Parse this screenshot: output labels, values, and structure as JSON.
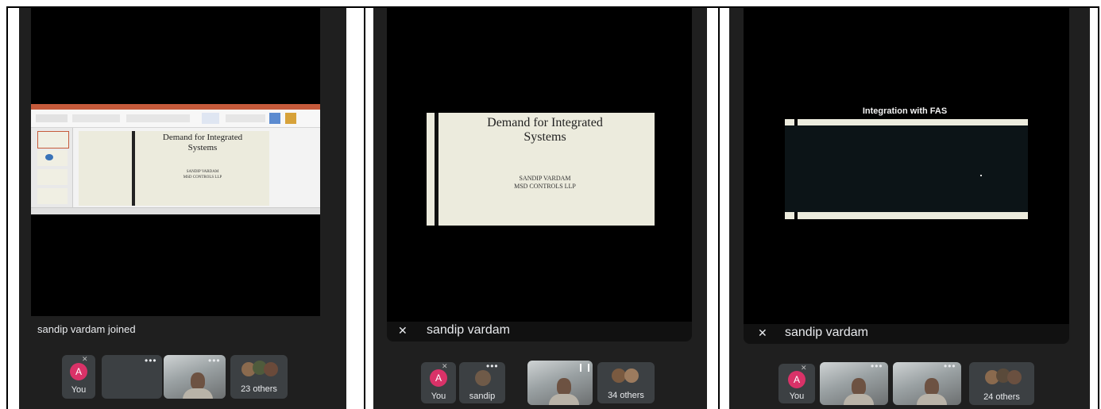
{
  "panels": [
    {
      "notice": "sandip vardam joined",
      "slide": {
        "title_line1": "Demand for Integrated",
        "title_line2": "Systems",
        "sub_line1": "SANDIP VARDAM",
        "sub_line2": "MSD CONTROLS LLP"
      },
      "tiles": {
        "you_label": "You",
        "avatar_letter": "A",
        "others_label": "23 others"
      }
    },
    {
      "presenter": "sandip vardam",
      "slide": {
        "title_line1": "Demand for Integrated",
        "title_line2": "Systems",
        "sub_line1": "SANDIP VARDAM",
        "sub_line2": "MSD CONTROLS LLP"
      },
      "tiles": {
        "you_label": "You",
        "avatar_letter": "A",
        "sandip_label": "sandip",
        "others_label": "34 others"
      }
    },
    {
      "presenter": "sandip vardam",
      "slide": {
        "title": "Integration with FAS"
      },
      "tiles": {
        "you_label": "You",
        "avatar_letter": "A",
        "others_label": "24 others"
      }
    }
  ],
  "icons": [
    "mic-off-icon",
    "more-options-icon"
  ],
  "colors": {
    "background": "#1f1f1f",
    "stage": "#000000",
    "tile": "#3c4043",
    "avatar": "#d93268",
    "slide_bg": "#ecebdd",
    "text": "#e8eaed"
  }
}
